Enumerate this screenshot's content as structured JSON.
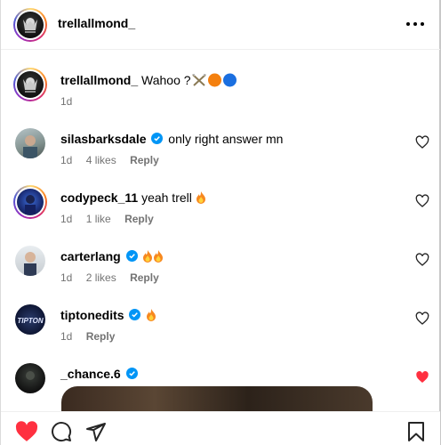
{
  "header": {
    "username": "trellallmond_",
    "avatar_icon": "profile-avatar",
    "more_icon": "more-horizontal-icon"
  },
  "caption": {
    "username": "trellallmond_",
    "text": "Wahoo ?",
    "emoji": [
      "crossed-swords",
      "orange-circle",
      "blue-circle"
    ],
    "time": "1d"
  },
  "comments": [
    {
      "username": "silasbarksdale",
      "verified": true,
      "text": "only right answer mn",
      "time": "1d",
      "likes": "4 likes",
      "reply": "Reply",
      "liked": false
    },
    {
      "username": "codypeck_11",
      "verified": false,
      "text": "yeah trell",
      "emoji": [
        "fire"
      ],
      "time": "1d",
      "likes": "1 like",
      "reply": "Reply",
      "liked": false
    },
    {
      "username": "carterlang",
      "verified": true,
      "text": "",
      "emoji": [
        "fire",
        "fire"
      ],
      "time": "1d",
      "likes": "2 likes",
      "reply": "Reply",
      "liked": false
    },
    {
      "username": "tiptonedits",
      "verified": true,
      "text": "",
      "emoji": [
        "fire"
      ],
      "time": "1d",
      "reply": "Reply",
      "liked": false
    },
    {
      "username": "_chance.6",
      "verified": true,
      "text": "",
      "liked": true
    }
  ],
  "footer": {
    "icons": [
      "heart-filled-icon",
      "comment-icon",
      "share-icon",
      "bookmark-icon"
    ],
    "like_color": "#ff3040"
  },
  "colors": {
    "verified": "#0095f6",
    "meta": "#737373",
    "like": "#ff3040"
  }
}
